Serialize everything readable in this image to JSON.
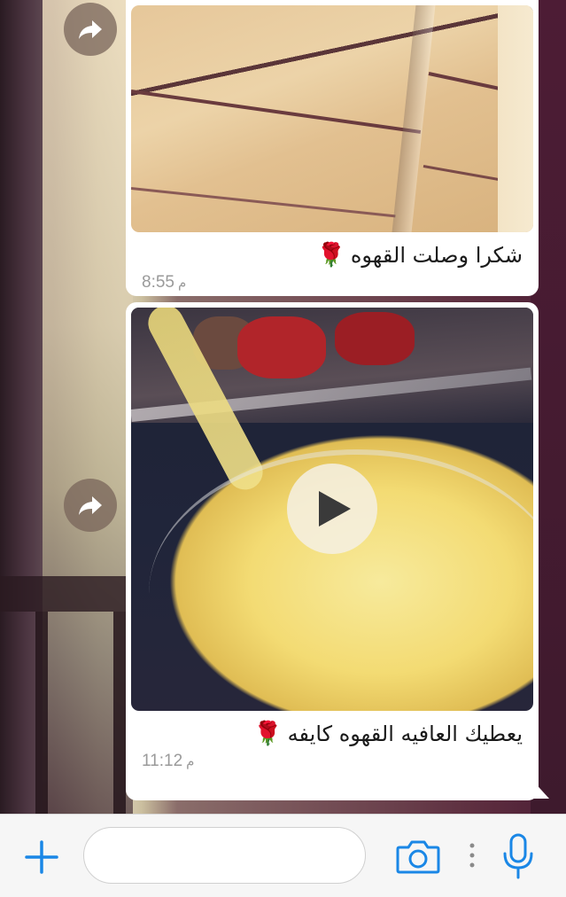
{
  "messages": [
    {
      "type": "photo",
      "caption": "شكرا وصلت القهوه",
      "emoji": "🌹",
      "time": "8:55",
      "time_suffix": "م"
    },
    {
      "type": "video",
      "caption": "يعطيك العافيه القهوه كايفه",
      "emoji": "🌹",
      "time": "11:12",
      "time_suffix": "م"
    }
  ],
  "composer": {
    "placeholder": ""
  },
  "colors": {
    "accent": "#1a87e6",
    "bubble": "#ffffff",
    "time": "#9a9a9a"
  },
  "icons": [
    "forward-icon",
    "play-icon",
    "plus-icon",
    "camera-icon",
    "more-dots-icon",
    "microphone-icon"
  ]
}
